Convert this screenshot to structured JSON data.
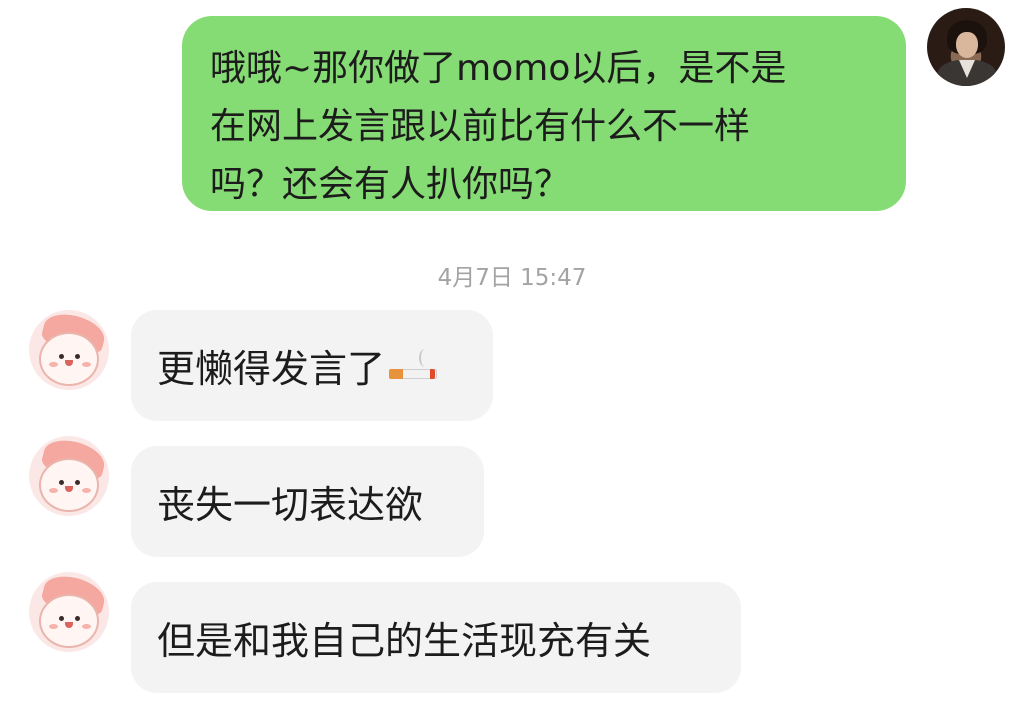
{
  "sent_message": {
    "lines": [
      "哦哦~那你做了momo以后，是不是",
      "在网上发言跟以前比有什么不一样",
      "吗？还会有人扒你吗？"
    ]
  },
  "timestamp": "4月7日 15:47",
  "received_messages": [
    {
      "text": "更懒得发言了",
      "emoji": "cigarette-emoji"
    },
    {
      "text": "丧失一切表达欲"
    },
    {
      "text": "但是和我自己的生活现充有关"
    }
  ],
  "colors": {
    "sent_bubble": "#86dc74",
    "received_bubble": "#f3f3f3",
    "timestamp_text": "#a3a3a3"
  }
}
